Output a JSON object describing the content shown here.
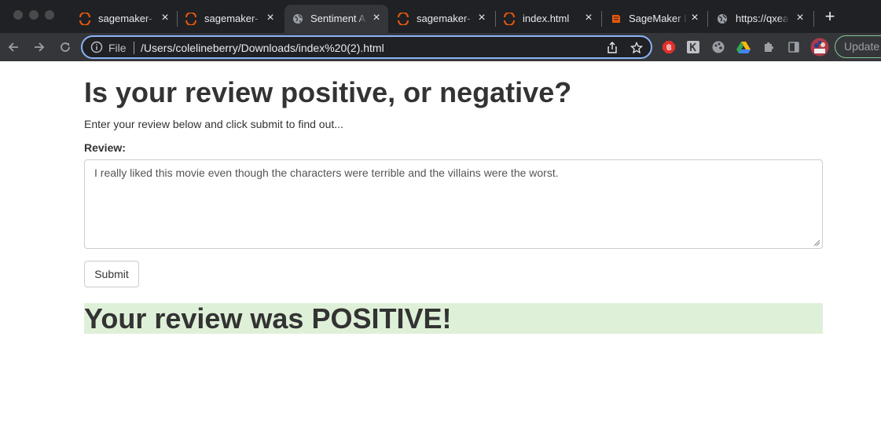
{
  "browser": {
    "tabs": [
      {
        "title": "sagemaker-",
        "favicon": "sagemaker-icon",
        "active": false
      },
      {
        "title": "sagemaker-",
        "favicon": "sagemaker-icon",
        "active": false
      },
      {
        "title": "Sentiment A",
        "favicon": "globe-icon",
        "active": true
      },
      {
        "title": "sagemaker-",
        "favicon": "sagemaker-icon",
        "active": false
      },
      {
        "title": "index.html",
        "favicon": "sagemaker-icon",
        "active": false
      },
      {
        "title": "SageMaker I",
        "favicon": "book-icon",
        "active": false
      },
      {
        "title": "https://qxea",
        "favicon": "globe-icon",
        "active": false
      }
    ],
    "address": {
      "scheme_label": "File",
      "url": "/Users/colelineberry/Downloads/index%20(2).html"
    },
    "update_label": "Update",
    "colors": {
      "frame": "#202124",
      "toolbar": "#35363a",
      "focus_ring": "#8ab4f8",
      "sagemaker_orange": "#e8590c"
    }
  },
  "page": {
    "heading": "Is your review positive, or negative?",
    "subtext": "Enter your review below and click submit to find out...",
    "review_label": "Review:",
    "review_text": "I really liked this movie even though the characters were terrible and the villains were the worst.",
    "submit_label": "Submit",
    "result": "Your review was POSITIVE!",
    "result_bg": "#dff0d8"
  }
}
